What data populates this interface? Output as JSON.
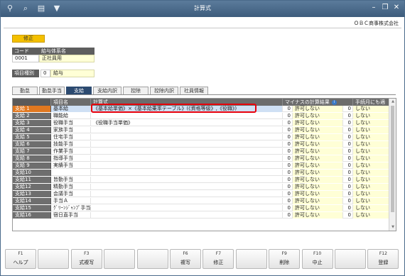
{
  "window": {
    "title": "計算式",
    "toolbar_icons": [
      "search-plus-icon",
      "zoom-icon",
      "print-icon",
      "filter-icon"
    ],
    "controls": [
      "minimize-icon",
      "restore-icon",
      "close-icon"
    ]
  },
  "company": "ＯＢＣ商事株式会社",
  "mode_badge": "修正",
  "header_table": {
    "code_label": "コード",
    "system_label": "給与体系名",
    "code": "0001",
    "system_name": "正社員用"
  },
  "item_type": {
    "label": "項目種別",
    "code": "0",
    "value": "給与"
  },
  "tabs": [
    "勤怠",
    "勤怠手当",
    "支給",
    "支給内訳",
    "控除",
    "控除内訳",
    "社員情報"
  ],
  "active_tab": "支給",
  "grid": {
    "headers": [
      "項目名",
      "計算式",
      "マイナスの計算結果",
      "手続月にも適用"
    ],
    "rows": [
      {
        "code": "支給 1",
        "name": "基本給",
        "formula": "《基本給単価》×《基本給乗率テーブル》(《資格等級》,《役職》)",
        "minus_code": "0",
        "minus": "許可しない",
        "prior_code": "0",
        "prior": "しない"
      },
      {
        "code": "支給 2",
        "name": "職能給",
        "formula": "",
        "minus_code": "0",
        "minus": "許可しない",
        "prior_code": "0",
        "prior": "しない"
      },
      {
        "code": "支給 3",
        "name": "役職手当",
        "formula": "《役職手当単価》",
        "minus_code": "0",
        "minus": "許可しない",
        "prior_code": "0",
        "prior": "しない"
      },
      {
        "code": "支給 4",
        "name": "家族手当",
        "formula": "",
        "minus_code": "0",
        "minus": "許可しない",
        "prior_code": "0",
        "prior": "しない"
      },
      {
        "code": "支給 5",
        "name": "住宅手当",
        "formula": "",
        "minus_code": "0",
        "minus": "許可しない",
        "prior_code": "0",
        "prior": "しない"
      },
      {
        "code": "支給 6",
        "name": "技能手当",
        "formula": "",
        "minus_code": "0",
        "minus": "許可しない",
        "prior_code": "0",
        "prior": "しない"
      },
      {
        "code": "支給 7",
        "name": "作業手当",
        "formula": "",
        "minus_code": "0",
        "minus": "許可しない",
        "prior_code": "0",
        "prior": "しない"
      },
      {
        "code": "支給 8",
        "name": "指導手当",
        "formula": "",
        "minus_code": "0",
        "minus": "許可しない",
        "prior_code": "0",
        "prior": "しない"
      },
      {
        "code": "支給 9",
        "name": "実績手当",
        "formula": "",
        "minus_code": "0",
        "minus": "許可しない",
        "prior_code": "0",
        "prior": "しない"
      },
      {
        "code": "支給10",
        "name": "",
        "formula": "",
        "minus_code": "0",
        "minus": "許可しない",
        "prior_code": "0",
        "prior": "しない"
      },
      {
        "code": "支給11",
        "name": "皆勤手当",
        "formula": "",
        "minus_code": "0",
        "minus": "許可しない",
        "prior_code": "0",
        "prior": "しない"
      },
      {
        "code": "支給12",
        "name": "精勤手当",
        "formula": "",
        "minus_code": "0",
        "minus": "許可しない",
        "prior_code": "0",
        "prior": "しない"
      },
      {
        "code": "支給13",
        "name": "会議手当",
        "formula": "",
        "minus_code": "0",
        "minus": "許可しない",
        "prior_code": "0",
        "prior": "しない"
      },
      {
        "code": "支給14",
        "name": "手当Ａ",
        "formula": "",
        "minus_code": "0",
        "minus": "許可しない",
        "prior_code": "0",
        "prior": "しない"
      },
      {
        "code": "支給15",
        "name": "ｸﾞﾘｰﾝｼﾞｬﾝﾌﾟ手当",
        "formula": "",
        "minus_code": "0",
        "minus": "許可しない",
        "prior_code": "0",
        "prior": "しない"
      },
      {
        "code": "支給16",
        "name": "宿日直手当",
        "formula": "",
        "minus_code": "0",
        "minus": "許可しない",
        "prior_code": "0",
        "prior": "しない"
      }
    ]
  },
  "fkeys": [
    {
      "code": "F1",
      "label": "ヘルプ"
    },
    {
      "code": "",
      "label": ""
    },
    {
      "code": "F3",
      "label": "式複写"
    },
    {
      "code": "",
      "label": ""
    },
    {
      "code": "",
      "label": ""
    },
    {
      "code": "F6",
      "label": "複写"
    },
    {
      "code": "F7",
      "label": "修正"
    },
    {
      "code": "",
      "label": ""
    },
    {
      "code": "F9",
      "label": "削除"
    },
    {
      "code": "F10",
      "label": "中止"
    },
    {
      "code": "",
      "label": ""
    },
    {
      "code": "F12",
      "label": "登録"
    }
  ]
}
